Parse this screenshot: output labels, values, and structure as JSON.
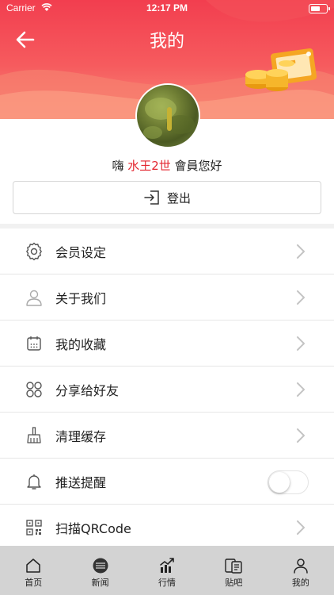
{
  "status_bar": {
    "carrier": "Carrier",
    "time": "12:17 PM"
  },
  "header": {
    "title": "我的"
  },
  "profile": {
    "greeting_prefix": "嗨 ",
    "username": "水王2世",
    "greeting_suffix": " 會員您好",
    "username_color": "#e3262f"
  },
  "logout": {
    "label": "登出",
    "icon": "logout-icon"
  },
  "menu": [
    {
      "label": "会员设定",
      "icon": "gear-icon"
    },
    {
      "label": "关于我们",
      "icon": "person-icon"
    },
    {
      "label": "我的收藏",
      "icon": "calendar-icon"
    },
    {
      "label": "分享给好友",
      "icon": "grid-icon"
    },
    {
      "label": "清理缓存",
      "icon": "broom-icon"
    },
    {
      "label": "推送提醒",
      "icon": "bell-icon",
      "toggle_on": false
    },
    {
      "label": "扫描QRCode",
      "icon": "qr-icon"
    }
  ],
  "tabbar": [
    {
      "label": "首页",
      "icon": "home-icon"
    },
    {
      "label": "新闻",
      "icon": "news-icon"
    },
    {
      "label": "行情",
      "icon": "trend-icon"
    },
    {
      "label": "贴吧",
      "icon": "forum-icon"
    },
    {
      "label": "我的",
      "icon": "profile-icon",
      "active": true
    }
  ],
  "colors": {
    "header_red": "#f23e4f",
    "accent": "#e3262f",
    "tabbar_bg": "#d3d3d3"
  }
}
